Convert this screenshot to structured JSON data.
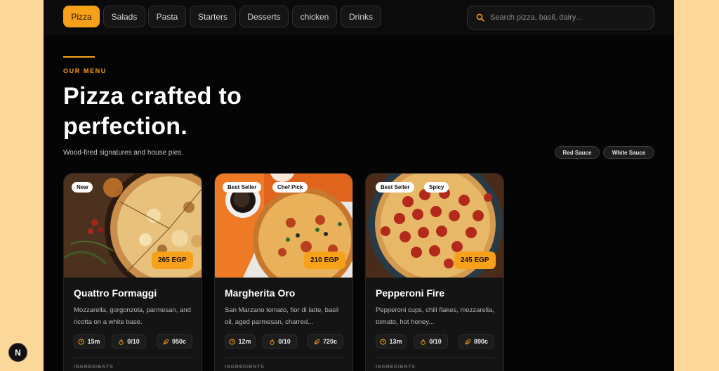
{
  "colors": {
    "accent": "#f7a11a",
    "background": "#050505",
    "page_bg": "#fbd89a"
  },
  "categories": [
    {
      "label": "Pizza",
      "active": true
    },
    {
      "label": "Salads",
      "active": false
    },
    {
      "label": "Pasta",
      "active": false
    },
    {
      "label": "Starters",
      "active": false
    },
    {
      "label": "Desserts",
      "active": false
    },
    {
      "label": "chicken",
      "active": false
    },
    {
      "label": "Drinks",
      "active": false
    }
  ],
  "search": {
    "placeholder": "Search pizza, basil, dairy...",
    "icon": "search-icon"
  },
  "hero": {
    "eyebrow": "OUR MENU",
    "title_line1": "Pizza crafted to",
    "title_line2": "perfection.",
    "subtitle": "Wood-fired signatures and house pies."
  },
  "filters": [
    "Red Sauce",
    "White Sauce"
  ],
  "cards": [
    {
      "name": "Quattro Formaggi",
      "description": "Mozzarella, gorgonzola, parmesan, and ricotta on a white base.",
      "price": "265 EGP",
      "badges": [
        "New"
      ],
      "time": "15m",
      "spice": "0/10",
      "calories": "950c",
      "ingredients_label": "INGREDIENTS"
    },
    {
      "name": "Margherita Oro",
      "description": "San Marzano tomato, fior di latte, basil oil, aged parmesan, charred...",
      "price": "210 EGP",
      "badges": [
        "Best Seller",
        "Chef Pick"
      ],
      "time": "12m",
      "spice": "0/10",
      "calories": "720c",
      "ingredients_label": "INGREDIENTS"
    },
    {
      "name": "Pepperoni Fire",
      "description": "Pepperoni cups, chili flakes, mozzarella, tomato, hot honey...",
      "price": "245 EGP",
      "badges": [
        "Best Seller",
        "Spicy"
      ],
      "time": "13m",
      "spice": "0/10",
      "calories": "890c",
      "ingredients_label": "INGREDIENTS"
    }
  ],
  "dev_indicator": "N"
}
